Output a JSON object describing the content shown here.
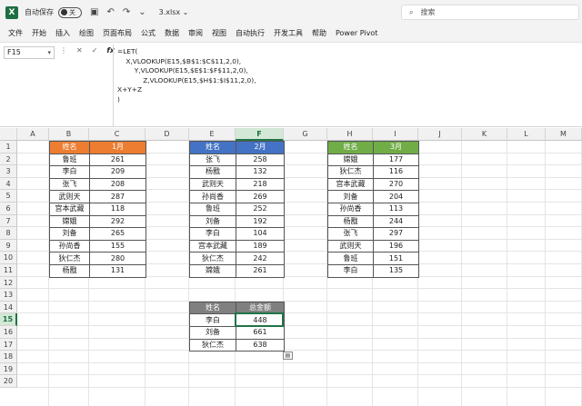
{
  "titlebar": {
    "autosave_label": "自动保存",
    "toggle_state": "关",
    "file_name": "3.xlsx ⌄",
    "search_placeholder": "搜索"
  },
  "menu": [
    "文件",
    "开始",
    "插入",
    "绘图",
    "页面布局",
    "公式",
    "数据",
    "审阅",
    "视图",
    "自动执行",
    "开发工具",
    "帮助",
    "Power Pivot"
  ],
  "formula_bar": {
    "cell_ref": "F15",
    "formula": "=LET(\n    X,VLOOKUP(E15,$B$1:$C$11,2,0),\n        Y,VLOOKUP(E15,$E$1:$F$11,2,0),\n            Z,VLOOKUP(E15,$H$1:$I$11,2,0),\nX+Y+Z\n)"
  },
  "columns": [
    "A",
    "B",
    "C",
    "D",
    "E",
    "F",
    "G",
    "H",
    "I",
    "J",
    "K",
    "L",
    "M"
  ],
  "rows": [
    "1",
    "2",
    "3",
    "4",
    "5",
    "6",
    "7",
    "8",
    "9",
    "10",
    "11",
    "12",
    "13",
    "14",
    "15",
    "16",
    "17",
    "18",
    "19",
    "20"
  ],
  "colors": {
    "t1_header": "#ed7d31",
    "t2_header": "#4472c4",
    "t3_header": "#70ad47",
    "t4_header": "#808080",
    "accent": "#217346"
  },
  "table1": {
    "headers": [
      "姓名",
      "1月"
    ],
    "rows": [
      [
        "鲁班",
        "261"
      ],
      [
        "李白",
        "209"
      ],
      [
        "张飞",
        "208"
      ],
      [
        "武则天",
        "287"
      ],
      [
        "宫本武藏",
        "118"
      ],
      [
        "嫦娥",
        "292"
      ],
      [
        "刘备",
        "265"
      ],
      [
        "孙尚香",
        "155"
      ],
      [
        "狄仁杰",
        "280"
      ],
      [
        "杨戬",
        "131"
      ]
    ]
  },
  "table2": {
    "headers": [
      "姓名",
      "2月"
    ],
    "rows": [
      [
        "张飞",
        "258"
      ],
      [
        "杨戬",
        "132"
      ],
      [
        "武则天",
        "218"
      ],
      [
        "孙尚香",
        "269"
      ],
      [
        "鲁班",
        "252"
      ],
      [
        "刘备",
        "192"
      ],
      [
        "李白",
        "104"
      ],
      [
        "宫本武藏",
        "189"
      ],
      [
        "狄仁杰",
        "242"
      ],
      [
        "嫦娥",
        "261"
      ]
    ]
  },
  "table3": {
    "headers": [
      "姓名",
      "3月"
    ],
    "rows": [
      [
        "嫦娥",
        "177"
      ],
      [
        "狄仁杰",
        "116"
      ],
      [
        "宫本武藏",
        "270"
      ],
      [
        "刘备",
        "204"
      ],
      [
        "孙尚香",
        "113"
      ],
      [
        "杨戬",
        "244"
      ],
      [
        "张飞",
        "297"
      ],
      [
        "武则天",
        "196"
      ],
      [
        "鲁班",
        "151"
      ],
      [
        "李白",
        "135"
      ]
    ]
  },
  "table4": {
    "headers": [
      "姓名",
      "总金额"
    ],
    "rows": [
      [
        "李白",
        "448"
      ],
      [
        "刘备",
        "661"
      ],
      [
        "狄仁杰",
        "638"
      ]
    ]
  }
}
